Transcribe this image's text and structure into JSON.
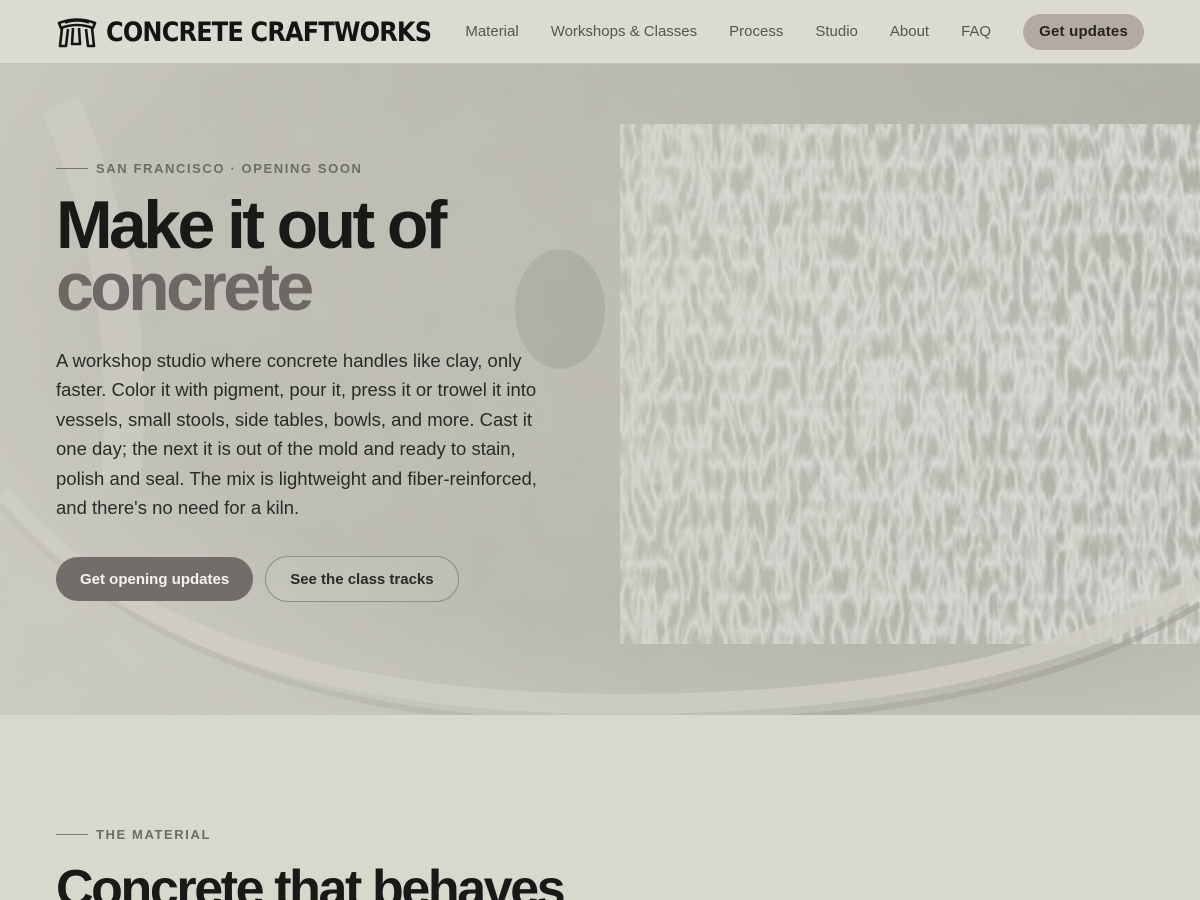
{
  "brand": {
    "name": "CONCRETE CRAFTWORKS",
    "logo_icon": "stool-icon"
  },
  "nav": {
    "items": [
      "Material",
      "Workshops & Classes",
      "Process",
      "Studio",
      "About",
      "FAQ"
    ],
    "cta_label": "Get updates"
  },
  "hero": {
    "eyebrow": "SAN FRANCISCO · OPENING SOON",
    "title_line1": "Make it out of",
    "title_line2": "concrete",
    "description": "A workshop studio where concrete handles like clay, only faster. Color it with pigment, pour it, press it or trowel it into vessels, small stools, side tables, bowls, and more. Cast it one day; the next it is out of the mold and ready to stain, polish and seal. The mix is lightweight and fiber-reinforced, and there's no need for a kiln.",
    "primary_button": "Get opening updates",
    "secondary_button": "See the class tracks"
  },
  "material": {
    "eyebrow": "THE MATERIAL",
    "title": "Concrete that behaves"
  },
  "colors": {
    "page_bg": "#d9d8cd",
    "header_bg": "#dcdbd1",
    "cta_bg": "#b3aba1",
    "primary_button_bg": "#726d6a",
    "title_accent": "#6c6865"
  }
}
